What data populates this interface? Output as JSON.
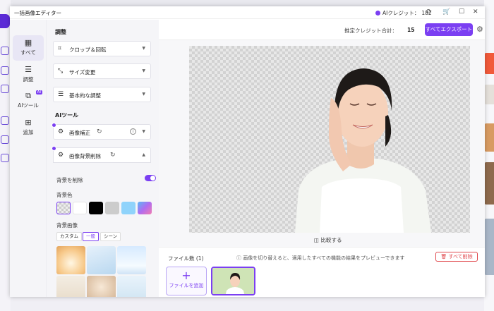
{
  "window": {
    "title": "一括画像エディター",
    "credit_label": "AIクレジット：",
    "credit_value": "182"
  },
  "nav": [
    {
      "label": "すべて",
      "icon": "grid-icon",
      "active": true
    },
    {
      "label": "調整",
      "icon": "sliders-icon"
    },
    {
      "label": "AIツール",
      "icon": "ai-icon",
      "badge": "AI"
    },
    {
      "label": "追加",
      "icon": "add-box-icon"
    }
  ],
  "panel": {
    "adjust_heading": "調整",
    "crop": "クロップ＆回転",
    "resize": "サイズ変更",
    "basic": "基本的な調整",
    "ai_heading": "AIツール",
    "enhance": "画像補正",
    "remove_bg": "画像背景削除",
    "remove_bg_toggle": "背景を削除",
    "bg_color": "背景色",
    "bg_image": "背景画像",
    "bg_tabs": [
      "カスタム",
      "一般",
      "シーン"
    ],
    "bg_tab_selected": "一般"
  },
  "main": {
    "estimated_label": "推定クレジット合計：",
    "estimated_value": "15",
    "export_label": "すべてエクスポート",
    "compare_label": "比較する",
    "files_label": "ファイル数 (1)",
    "files_tip": "画像を切り替えると、適用したすべての機能の結果をプレビューできます",
    "delete_all": "すべて削除",
    "add_file": "ファイルを追加"
  },
  "colors": {
    "accent": "#7b3ff2",
    "danger": "#e0474c",
    "swatches": [
      "#ffffff",
      "#000000",
      "#cccccc",
      "#8fd3fb",
      "#b06cf0"
    ]
  }
}
